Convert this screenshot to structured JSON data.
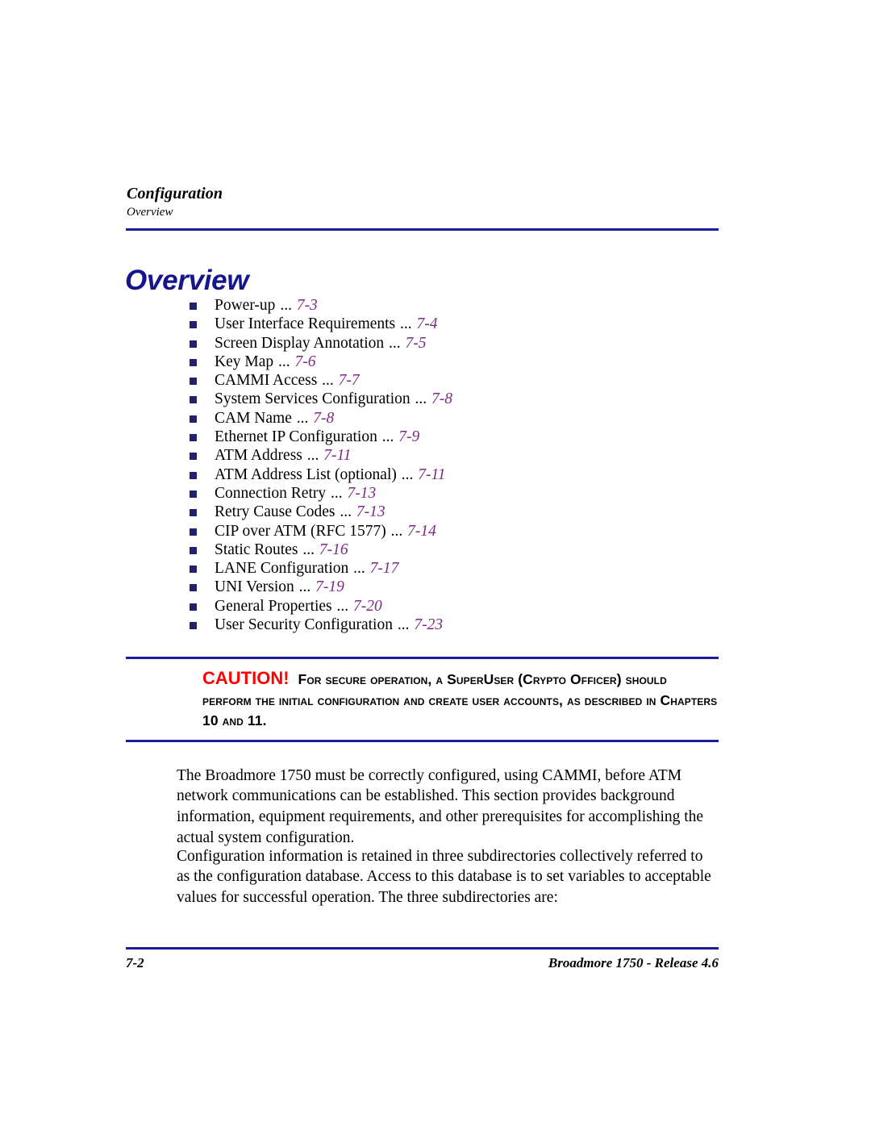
{
  "document": {
    "background_color": "#ffffff",
    "accent_navy": "#1d1d99",
    "heading_navy": "#16168c",
    "page_ref_purple": "#7d2a82",
    "caution_red": "#ff0000"
  },
  "running_header": {
    "chapter": "Configuration",
    "section": "Overview"
  },
  "heading": {
    "title": "Overview"
  },
  "toc": {
    "items": [
      {
        "label": "Power-up",
        "dots": "...",
        "page": "7-3"
      },
      {
        "label": "User Interface Requirements",
        "dots": "...",
        "page": "7-4"
      },
      {
        "label": "Screen Display Annotation",
        "dots": "...",
        "page": "7-5"
      },
      {
        "label": "Key Map",
        "dots": "...",
        "page": "7-6"
      },
      {
        "label": "CAMMI Access",
        "dots": "...",
        "page": "7-7"
      },
      {
        "label": "System Services Configuration",
        "dots": "...",
        "page": "7-8"
      },
      {
        "label": "CAM Name",
        "dots": "...",
        "page": "7-8"
      },
      {
        "label": "Ethernet IP Configuration",
        "dots": "...",
        "page": "7-9"
      },
      {
        "label": "ATM Address",
        "dots": "...",
        "page": "7-11"
      },
      {
        "label": "ATM Address List (optional)",
        "dots": "...",
        "page": "7-11"
      },
      {
        "label": "Connection Retry",
        "dots": "...",
        "page": "7-13"
      },
      {
        "label": "Retry Cause Codes",
        "dots": "...",
        "page": "7-13"
      },
      {
        "label": "CIP over ATM (RFC 1577)",
        "dots": "...",
        "page": "7-14"
      },
      {
        "label": "Static Routes",
        "dots": "...",
        "page": "7-16"
      },
      {
        "label": "LANE Configuration",
        "dots": "...",
        "page": "7-17"
      },
      {
        "label": "UNI Version",
        "dots": "...",
        "page": "7-19"
      },
      {
        "label": "General Properties",
        "dots": "...",
        "page": "7-20"
      },
      {
        "label": "User Security Configuration",
        "dots": "...",
        "page": "7-23"
      }
    ]
  },
  "caution": {
    "keyword": "CAUTION!",
    "text": "For secure operation, a SuperUser (Crypto Officer) should perform the initial configuration and create user accounts, as described in Chapters 10 and 11."
  },
  "paragraphs": {
    "p1": "The Broadmore 1750 must be correctly configured, using CAMMI, before ATM network communications can be established. This section provides background information, equipment requirements, and other prerequisites for accomplishing the actual system configuration.",
    "p2": "Configuration information is retained in three subdirectories collectively referred to as the configuration database. Access to this database is to set variables to acceptable values for successful operation. The three subdirectories are:"
  },
  "footer": {
    "page_number": "7-2",
    "document_title": "Broadmore 1750 - Release 4.6"
  }
}
